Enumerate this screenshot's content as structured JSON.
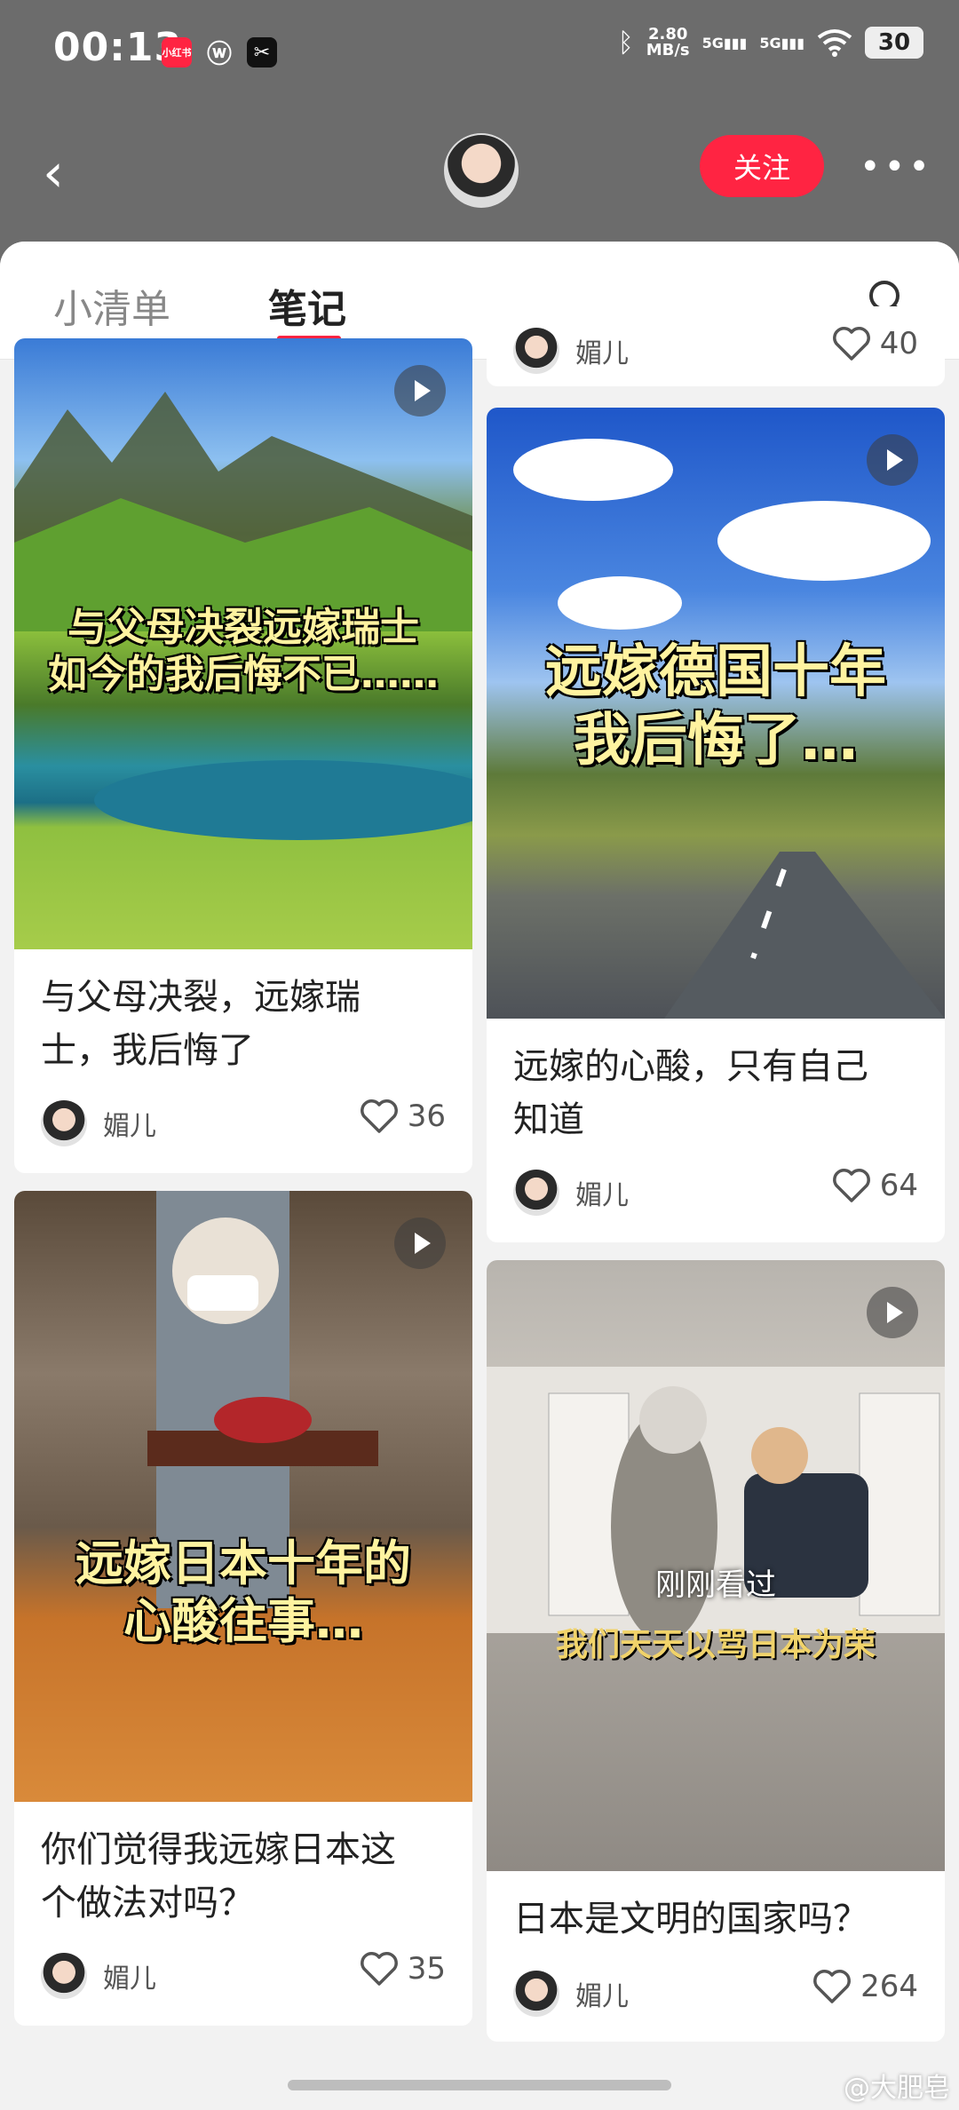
{
  "status_bar": {
    "time": "00:13",
    "app_icons": [
      "小红书",
      "weibo-icon",
      "capcut-icon"
    ],
    "net_speed_value": "2.80",
    "net_speed_unit": "MB/s",
    "signal1": "5G",
    "signal2": "5G",
    "battery": "30"
  },
  "nav": {
    "follow_label": "关注",
    "more_label": "•••",
    "back_label": "‹"
  },
  "tabs": [
    {
      "label": "小清单",
      "active": false
    },
    {
      "label": "笔记",
      "active": true
    }
  ],
  "top_partial": {
    "author": "媚儿",
    "likes": "40"
  },
  "notes": [
    {
      "overlay": [
        "与父母决裂远嫁瑞士",
        "如今的我后悔不已……"
      ],
      "title": "与父母决裂，远嫁瑞士，我后悔了",
      "title_lines": [
        "与父母决裂，远嫁瑞",
        "士，我后悔了"
      ],
      "author": "媚儿",
      "likes": "36"
    },
    {
      "overlay": [
        "远嫁德国十年",
        "我后悔了…"
      ],
      "title": "远嫁的心酸，只有自己知道",
      "title_lines": [
        "远嫁的心酸，只有自己",
        "知道"
      ],
      "author": "媚儿",
      "likes": "64"
    },
    {
      "overlay": [
        "远嫁日本十年的",
        "心酸往事…"
      ],
      "title": "你们觉得我远嫁日本这个做法对吗？",
      "title_lines": [
        "你们觉得我远嫁日本这",
        "个做法对吗？"
      ],
      "author": "媚儿",
      "likes": "35"
    },
    {
      "recent_label": "刚刚看过",
      "sub_caption": "我们天天以骂日本为荣",
      "title": "日本是文明的国家吗？",
      "title_lines": [
        "日本是文明的国家吗？"
      ],
      "author": "媚儿",
      "likes": "264"
    }
  ],
  "watermark": "@大肥皂",
  "colors": {
    "accent": "#ff2442",
    "overlay_gray": "#6c6c6c",
    "page_bg": "#f2f2f2"
  }
}
